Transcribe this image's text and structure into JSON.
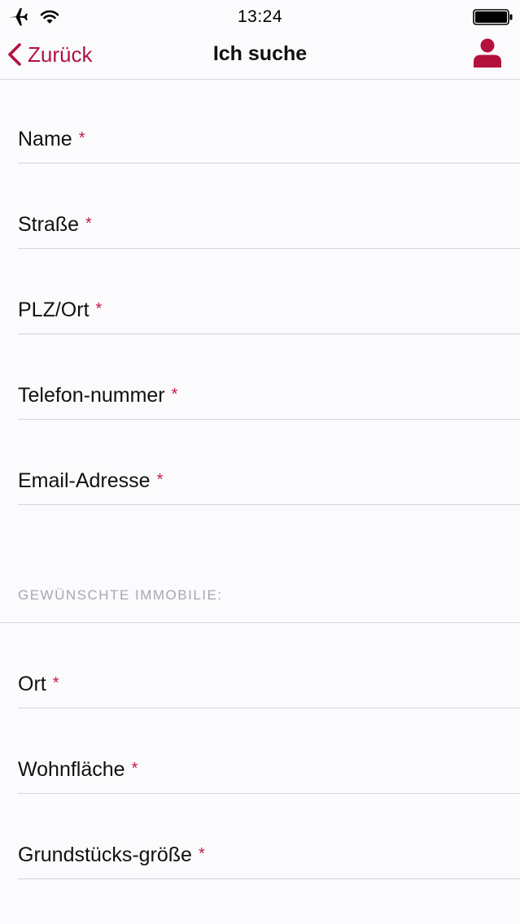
{
  "status_bar": {
    "time": "13:24",
    "icons": [
      "airplane-icon",
      "wifi-icon",
      "battery-icon"
    ]
  },
  "nav": {
    "back_label": "Zurück",
    "title": "Ich suche",
    "profile_icon": "user-icon"
  },
  "colors": {
    "accent": "#b3123e",
    "required_asterisk": "#c41a45",
    "divider": "#d5d5da",
    "section_header": "#a7a7ad",
    "background": "#fbfbfd"
  },
  "contact_fields": [
    {
      "label": "Name",
      "required": "*"
    },
    {
      "label": "Straße",
      "required": "*"
    },
    {
      "label": "PLZ/Ort",
      "required": "*"
    },
    {
      "label": "Telefon-nummer",
      "required": "*"
    },
    {
      "label": "Email-Adresse",
      "required": "*"
    }
  ],
  "section": {
    "title": "GEWÜNSCHTE IMMOBILIE:"
  },
  "property_fields": [
    {
      "label": "Ort",
      "required": "*"
    },
    {
      "label": "Wohnfläche",
      "required": "*"
    },
    {
      "label": "Grundstücks-größe",
      "required": "*"
    }
  ]
}
